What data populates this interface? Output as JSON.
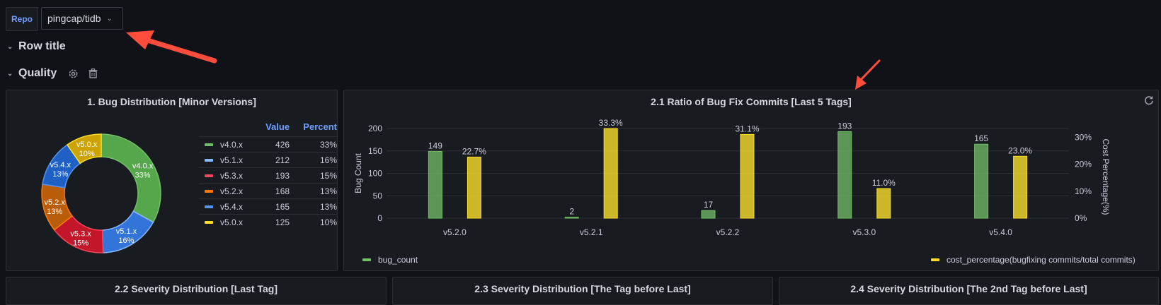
{
  "topbar": {
    "repo_label": "Repo",
    "repo_value": "pingcap/tidb"
  },
  "rows": {
    "row1_title": "Row title",
    "row2_title": "Quality"
  },
  "panel1": {
    "title": "1. Bug Distribution [Minor Versions]",
    "legend_headers": {
      "value": "Value",
      "percent": "Percent"
    },
    "items": [
      {
        "name": "v4.0.x",
        "value": 426,
        "percent": "33%",
        "color": "#56a64b"
      },
      {
        "name": "v5.1.x",
        "value": 212,
        "percent": "16%",
        "color": "#3274d9"
      },
      {
        "name": "v5.3.x",
        "value": 193,
        "percent": "15%",
        "color": "#c4162a"
      },
      {
        "name": "v5.2.x",
        "value": 168,
        "percent": "13%",
        "color": "#b95d0b"
      },
      {
        "name": "v5.4.x",
        "value": 165,
        "percent": "13%",
        "color": "#1f60c4"
      },
      {
        "name": "v5.0.x",
        "value": 125,
        "percent": "10%",
        "color": "#cca300"
      }
    ],
    "legend_colors": [
      "#73bf69",
      "#8ab8ff",
      "#f2495c",
      "#ff780a",
      "#5794f2",
      "#fade2a"
    ]
  },
  "panel2": {
    "title": "2.1 Ratio of Bug Fix Commits [Last 5 Tags]",
    "refresh_icon": "refresh-icon"
  },
  "chart_data": {
    "type": "bar",
    "title": "2.1 Ratio of Bug Fix Commits [Last 5 Tags]",
    "categories": [
      "v5.2.0",
      "v5.2.1",
      "v5.2.2",
      "v5.3.0",
      "v5.4.0"
    ],
    "series": [
      {
        "name": "bug_count",
        "axis": "left",
        "values": [
          149,
          2,
          17,
          193,
          165
        ],
        "labels": [
          "149",
          "2",
          "17",
          "193",
          "165"
        ],
        "color": "#73bf69"
      },
      {
        "name": "cost_percentage(bugfixing commits/total commits)",
        "axis": "right",
        "values": [
          22.7,
          33.3,
          31.1,
          11.0,
          23.0
        ],
        "labels": [
          "22.7%",
          "33.3%",
          "31.1%",
          "11.0%",
          "23.0%"
        ],
        "color": "#fade2a"
      }
    ],
    "ylabel": "Bug Count",
    "y2label": "Cost Percentage(%)",
    "ylim": [
      0,
      200
    ],
    "y2lim": [
      0,
      33.3
    ],
    "yticks": [
      "0",
      "50",
      "100",
      "150",
      "200"
    ],
    "y2ticks": [
      "0%",
      "10%",
      "20%",
      "30%"
    ],
    "grid": true,
    "legend": "bottom"
  },
  "bottom_panels": [
    {
      "title": "2.2 Severity Distribution [Last Tag]"
    },
    {
      "title": "2.3 Severity Distribution [The Tag before Last]"
    },
    {
      "title": "2.4 Severity Distribution [The 2nd Tag before Last]"
    }
  ]
}
